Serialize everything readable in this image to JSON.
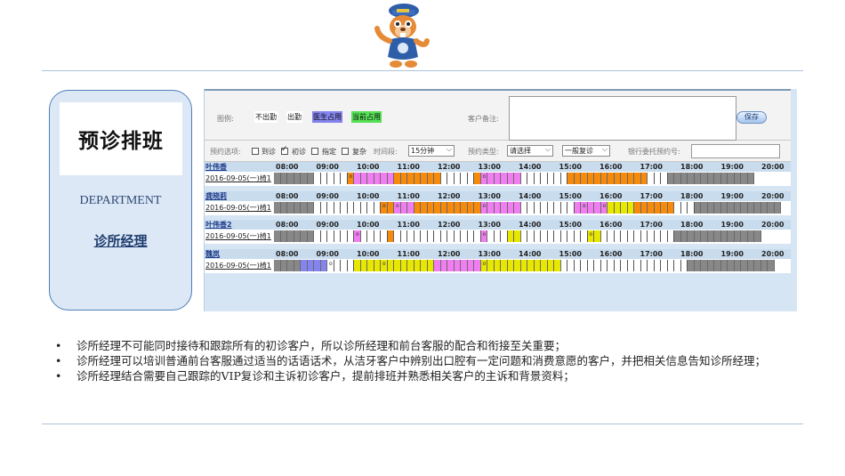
{
  "left_card": {
    "title": "预诊排班",
    "department": "DEPARTMENT",
    "role": "诊所经理"
  },
  "app": {
    "legend_label": "图例:",
    "legend_items": [
      "不出勤",
      "出勤",
      "医生占用",
      "当前占用"
    ],
    "notes_label": "客户备注:",
    "save_label": "保存",
    "booking_options_label": "预约选项:",
    "checkboxes": [
      {
        "label": "到诊",
        "checked": false
      },
      {
        "label": "初诊",
        "checked": true
      },
      {
        "label": "指定",
        "checked": false
      },
      {
        "label": "复杂",
        "checked": false
      }
    ],
    "time_label": "时间段:",
    "time_value": "15分钟",
    "type_label": "预约类型:",
    "type_value": "请选择",
    "revisit_value": "一般复诊",
    "bank_label": "银行委托预约号:",
    "hours": [
      "08:00",
      "09:00",
      "10:00",
      "11:00",
      "12:00",
      "13:00",
      "14:00",
      "15:00",
      "16:00",
      "17:00",
      "18:00",
      "19:00",
      "20:00"
    ],
    "slot_mark": "o",
    "colors": {
      "off": "#888888",
      "free": "#ffffff",
      "booked_orange": "#f58a0c",
      "booked_pink": "#f07ef0",
      "booked_yellow": "#e7e700",
      "doctor": "#8484ee"
    },
    "schedules": [
      {
        "name": "叶伟香",
        "date": "2016-09-05(一)椅1",
        "slots": "ggggggwwwwwoppppppooooooowwwwwoppppppwwwwwwwoooooooooooowwwggggggggggggg",
        "marks": [
          11,
          31
        ]
      },
      {
        "name": "龚晓莉",
        "date": "2016-09-05(一)椅1",
        "slots": "ggggggwwwwwwwwwwoopppooooooooooppppppwwwwwwwwpppppyyyyoooooowwwggggggggggggg",
        "marks": [
          16,
          18,
          31,
          46,
          49
        ]
      },
      {
        "name": "叶伟香2",
        "date": "2016-09-05(一)椅1",
        "slots": "ggggggwwwwwwpwwwwowwwwwwwwwwwwwpwwwyywwwwwwwwwwyywwwwwwwwwwwggggggggggggg",
        "marks": [
          12,
          31,
          47
        ]
      },
      {
        "name": "魏岚",
        "date": "2016-09-05(一)椅1",
        "slots": "ggggbbbbwwwwyyyyyyyyyyyypppppppyyyyyyyyyyyywwwwwwwwwwwwwwwwwwwggggggggggggg",
        "marks": [
          8,
          16,
          31
        ]
      }
    ]
  },
  "bullets": [
    "诊所经理不可能同时接待和跟踪所有的初诊客户，所以诊所经理和前台客服的配合和衔接至关重要；",
    "诊所经理可以培训普通前台客服通过适当的话语话术，从洁牙客户中辨别出口腔有一定问题和消费意愿的客户，并把相关信息告知诊所经理；",
    "诊所经理结合需要自己跟踪的VIP复诊和主诉初诊客户，提前排班并熟悉相关客户的主诉和背景资料；"
  ]
}
